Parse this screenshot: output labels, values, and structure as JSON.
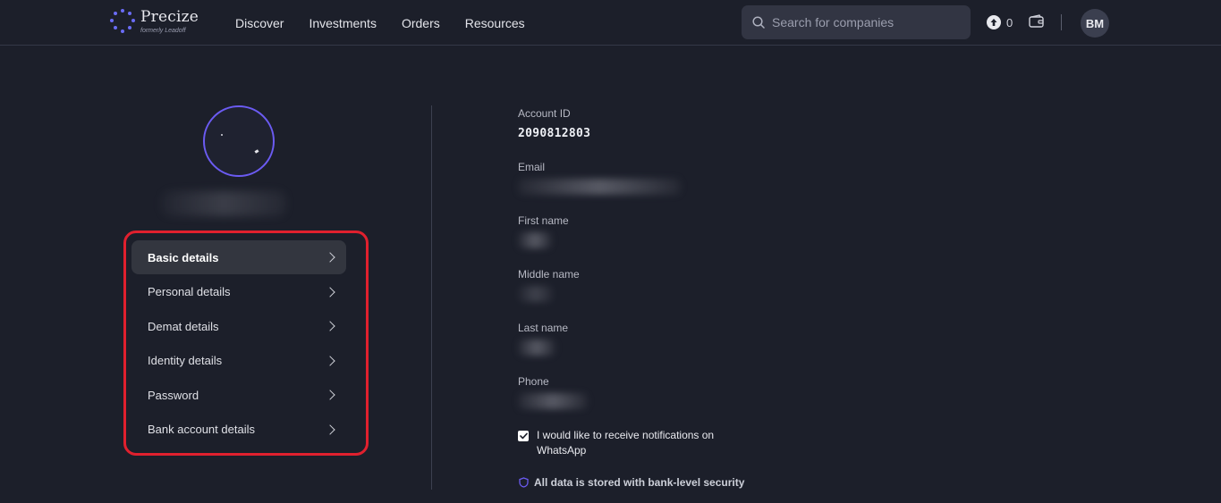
{
  "brand": {
    "name": "Precize",
    "subtitle": "formerly Leadoff"
  },
  "nav": {
    "items": [
      "Discover",
      "Investments",
      "Orders",
      "Resources"
    ]
  },
  "search": {
    "placeholder": "Search for companies"
  },
  "header": {
    "coin_count": "0",
    "avatar_initials": "BM"
  },
  "sidebar": {
    "items": [
      {
        "label": "Basic details",
        "active": true
      },
      {
        "label": "Personal details",
        "active": false
      },
      {
        "label": "Demat details",
        "active": false
      },
      {
        "label": "Identity details",
        "active": false
      },
      {
        "label": "Password",
        "active": false
      },
      {
        "label": "Bank account details",
        "active": false
      }
    ]
  },
  "details": {
    "account_id_label": "Account ID",
    "account_id_value": "2090812803",
    "email_label": "Email",
    "first_name_label": "First name",
    "middle_name_label": "Middle name",
    "last_name_label": "Last name",
    "phone_label": "Phone"
  },
  "whatsapp": {
    "checked": true,
    "label": "I would like to receive notifications on WhatsApp"
  },
  "security_note": "All data is stored with bank-level security",
  "colors": {
    "background": "#1c1f2a",
    "accent": "#6b5bf2",
    "highlight_box": "#e0202e",
    "active_item_bg": "#33363f"
  }
}
